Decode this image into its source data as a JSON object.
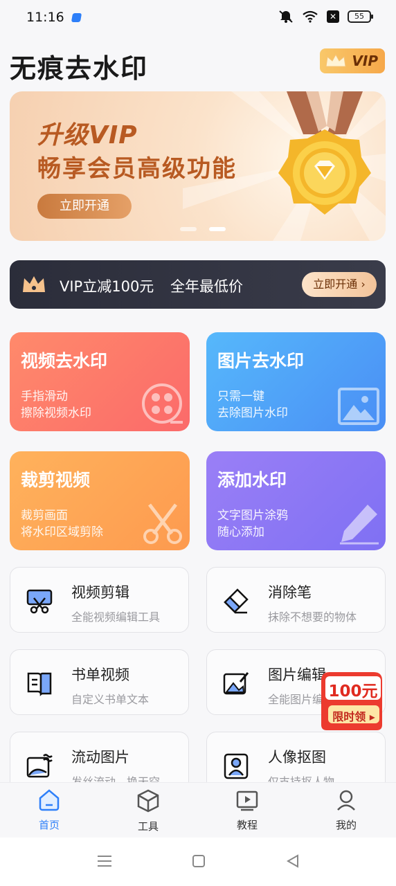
{
  "status_bar": {
    "time": "11:16",
    "battery": "55",
    "icons": [
      "mute-icon",
      "wifi-icon",
      "close-box-icon",
      "battery-icon"
    ]
  },
  "header": {
    "title": "无痕去水印",
    "vip_label": "VIP"
  },
  "banner": {
    "line1": "升级VIP",
    "line2": "畅享会员高级功能",
    "button": "立即开通",
    "slides": 2,
    "active_slide": 2
  },
  "vip_strip": {
    "text1": "VIP立减100元",
    "text2": "全年最低价",
    "button": "立即开通"
  },
  "feature_cards": [
    {
      "title": "视频去水印",
      "sub1": "手指滑动",
      "sub2": "擦除视频水印",
      "color": "#fb7a6a"
    },
    {
      "title": "图片去水印",
      "sub1": "只需一键",
      "sub2": "去除图片水印",
      "color": "#50a6f8"
    },
    {
      "title": "裁剪视频",
      "sub1": "裁剪画面",
      "sub2": "将水印区域剪除",
      "color": "#fea855"
    },
    {
      "title": "添加水印",
      "sub1": "文字图片涂鸦",
      "sub2": "随心添加",
      "color": "#8d78f5"
    }
  ],
  "tools": [
    {
      "title": "视频剪辑",
      "sub": "全能视频编辑工具",
      "icon": "video-cut-icon"
    },
    {
      "title": "消除笔",
      "sub": "抹除不想要的物体",
      "icon": "eraser-icon"
    },
    {
      "title": "书单视频",
      "sub": "自定义书单文本",
      "icon": "book-icon"
    },
    {
      "title": "图片编辑",
      "sub": "全能图片编辑",
      "icon": "image-edit-icon"
    },
    {
      "title": "流动图片",
      "sub": "发丝流动，换天空",
      "icon": "flow-image-icon"
    },
    {
      "title": "人像抠图",
      "sub": "仅支持抠人物",
      "icon": "portrait-icon"
    }
  ],
  "promo": {
    "amount": "100元",
    "label": "限时领"
  },
  "bottom_nav": [
    {
      "label": "首页",
      "active": true
    },
    {
      "label": "工具",
      "active": false
    },
    {
      "label": "教程",
      "active": false
    },
    {
      "label": "我的",
      "active": false
    }
  ],
  "colors": {
    "accent": "#2d7ff9",
    "vip_gold": "#f6a84a"
  }
}
